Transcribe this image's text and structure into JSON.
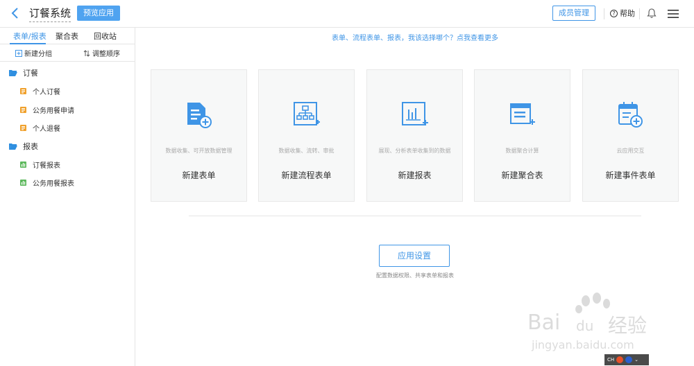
{
  "header": {
    "app_title": "订餐系统",
    "preview_label": "预览应用",
    "member_label": "成员管理",
    "help_label": "帮助"
  },
  "sidebar": {
    "tabs": [
      "表单/报表",
      "聚合表",
      "回收站"
    ],
    "actions": {
      "new_group": "新建分组",
      "reorder": "调整顺序"
    },
    "groups": [
      {
        "name": "订餐",
        "items": [
          "个人订餐",
          "公务用餐申请",
          "个人退餐"
        ]
      },
      {
        "name": "报表",
        "items": [
          "订餐报表",
          "公务用餐报表"
        ]
      }
    ]
  },
  "main": {
    "hint": "表单、流程表单、报表，我该选择哪个？点我查看更多",
    "cards": [
      {
        "desc": "数据收集、可开放数据管理",
        "title": "新建表单"
      },
      {
        "desc": "数据收集、流转、审批",
        "title": "新建流程表单"
      },
      {
        "desc": "展现、分析表单收集到的数据",
        "title": "新建报表"
      },
      {
        "desc": "数据聚合计算",
        "title": "新建聚合表"
      },
      {
        "desc": "云应用交互",
        "title": "新建事件表单"
      }
    ],
    "settings_label": "应用设置",
    "settings_desc": "配置数据权限、共享表单和报表"
  },
  "watermark": {
    "brand": "Bai",
    "brand2": "du",
    "brand3": "经验",
    "url": "jingyan.baidu.com"
  },
  "taskbar": {
    "lang": "CH"
  },
  "colors": {
    "accent": "#3f95e6",
    "button": "#4fa3f0",
    "folder": "#2f8fe0",
    "form_item": "#f0a02a",
    "report_item": "#5cb85c"
  }
}
